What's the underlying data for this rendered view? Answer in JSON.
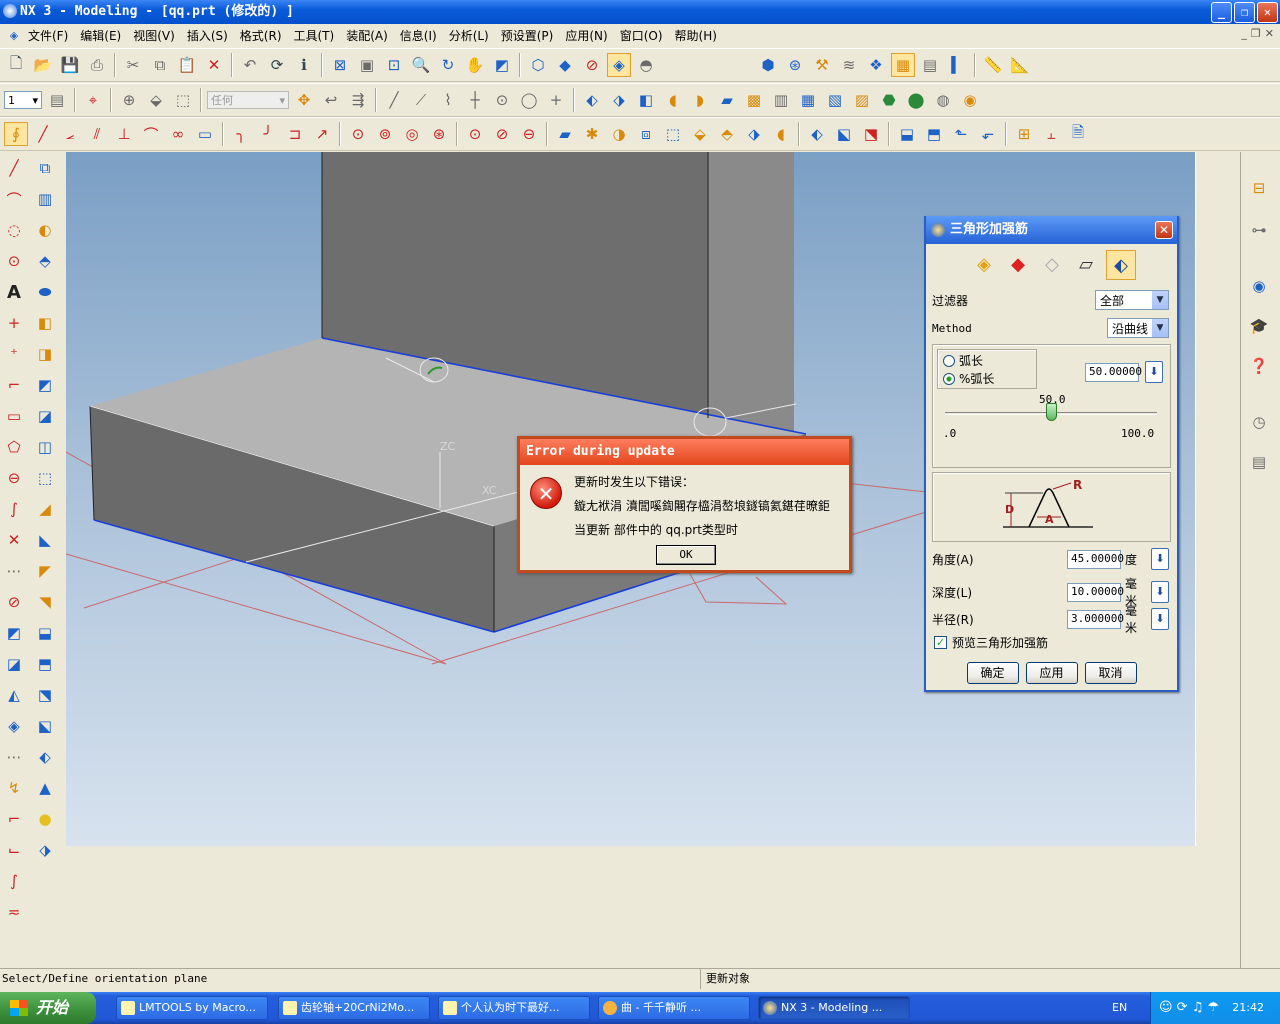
{
  "window": {
    "title": "NX 3 - Modeling - [qq.prt  (修改的) ]",
    "buttons": {
      "minimize": "_",
      "maximize": "❐",
      "close": "✕"
    }
  },
  "menubar": {
    "items": [
      "文件(F)",
      "编辑(E)",
      "视图(V)",
      "插入(S)",
      "格式(R)",
      "工具(T)",
      "装配(A)",
      "信息(I)",
      "分析(L)",
      "预设置(P)",
      "应用(N)",
      "窗口(O)",
      "帮助(H)"
    ]
  },
  "toolbar2": {
    "layer_value": "1",
    "filter_value": "任何"
  },
  "dialog": {
    "title": "三角形加强筋",
    "close": "✕",
    "filter_label": "过滤器",
    "filter_value": "全部",
    "method_label": "Method",
    "method_value": "沿曲线",
    "radio_arc": "弧长",
    "radio_pct": "%弧长",
    "arc_value": "50.00000",
    "slider_value": "50.0",
    "slider_min": ".0",
    "slider_max": "100.0",
    "slider_level": 0.5,
    "diagram_labels": {
      "r": "R",
      "d": "D",
      "a": "A"
    },
    "angle_label": "角度(A)",
    "angle_value": "45.00000",
    "angle_unit": "度",
    "depth_label": "深度(L)",
    "depth_value": "10.00000",
    "depth_unit": "毫米",
    "radius_label": "半径(R)",
    "radius_value": "3.000000",
    "radius_unit": "毫米",
    "preview_label": "预览三角形加强筋",
    "preview_checked": true,
    "ok": "确定",
    "apply": "应用",
    "cancel": "取消"
  },
  "error": {
    "title": "Error during update",
    "line1": "更新时发生以下错误：",
    "line2": "鏇尢袱涓   濆閭嗘鍧闀存橀涓嶅埌鐩镐氦鍖荏暸鉅",
    "line3": "当更新 部件中的 qq.prt类型时",
    "ok": "OK"
  },
  "status": {
    "left": "Select/Define orientation plane",
    "right": "更新对象"
  },
  "taskbar": {
    "start": "开始",
    "tasks": [
      "LMTOOLS by Macro...",
      "齿轮轴+20CrNi2Mo...",
      "个人认为时下最好...",
      "曲 - 千千静听      ...",
      "NX 3 - Modeling ..."
    ],
    "lang": "EN",
    "clock": "21:42"
  },
  "viewport": {
    "axis_zc": "ZC",
    "axis_xc": "XC"
  }
}
